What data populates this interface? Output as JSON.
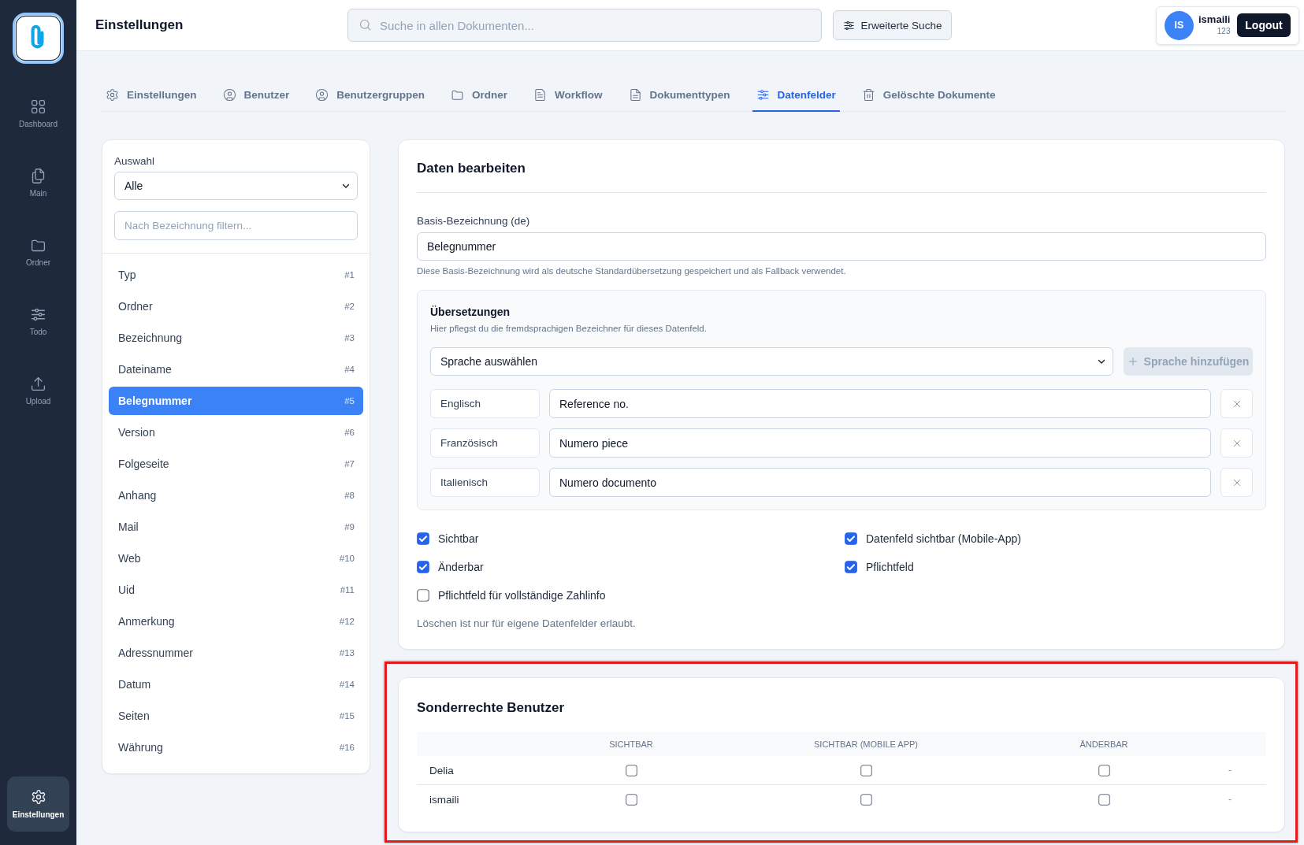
{
  "sidebar": {
    "items": [
      {
        "label": "Dashboard",
        "selected": false
      },
      {
        "label": "Main",
        "selected": false
      },
      {
        "label": "Ordner",
        "selected": false
      },
      {
        "label": "Todo",
        "selected": false
      },
      {
        "label": "Upload",
        "selected": false
      }
    ],
    "bottom_items": [
      {
        "label": "Einstellungen",
        "selected": true
      }
    ]
  },
  "header": {
    "title": "Einstellungen",
    "search": {
      "placeholder": "Suche in allen Dokumenten..."
    },
    "advanced_search_button": "Erweiterte Suche",
    "user": {
      "initials": "IS",
      "name": "ismaili",
      "detail": "123"
    },
    "logout_button": "Logout"
  },
  "tabs": [
    {
      "label": "Einstellungen",
      "selected": false
    },
    {
      "label": "Benutzer",
      "selected": false
    },
    {
      "label": "Benutzergruppen",
      "selected": false
    },
    {
      "label": "Ordner",
      "selected": false
    },
    {
      "label": "Workflow",
      "selected": false
    },
    {
      "label": "Dokumenttypen",
      "selected": false
    },
    {
      "label": "Datenfelder",
      "selected": true
    },
    {
      "label": "Gelöschte Dokumente",
      "selected": false
    }
  ],
  "field_list": {
    "selection_label": "Auswahl",
    "selection_value": "Alle",
    "filter": {
      "placeholder": "Nach Bezeichnung filtern..."
    },
    "items": [
      {
        "label": "Typ",
        "number": "#1",
        "selected": false
      },
      {
        "label": "Ordner",
        "number": "#2",
        "selected": false
      },
      {
        "label": "Bezeichnung",
        "number": "#3",
        "selected": false
      },
      {
        "label": "Dateiname",
        "number": "#4",
        "selected": false
      },
      {
        "label": "Belegnummer",
        "number": "#5",
        "selected": true
      },
      {
        "label": "Version",
        "number": "#6",
        "selected": false
      },
      {
        "label": "Folgeseite",
        "number": "#7",
        "selected": false
      },
      {
        "label": "Anhang",
        "number": "#8",
        "selected": false
      },
      {
        "label": "Mail",
        "number": "#9",
        "selected": false
      },
      {
        "label": "Web",
        "number": "#10",
        "selected": false
      },
      {
        "label": "Uid",
        "number": "#11",
        "selected": false
      },
      {
        "label": "Anmerkung",
        "number": "#12",
        "selected": false
      },
      {
        "label": "Adressnummer",
        "number": "#13",
        "selected": false
      },
      {
        "label": "Datum",
        "number": "#14",
        "selected": false
      },
      {
        "label": "Seiten",
        "number": "#15",
        "selected": false
      },
      {
        "label": "Währung",
        "number": "#16",
        "selected": false
      }
    ]
  },
  "editor": {
    "title": "Daten bearbeiten",
    "base_label_field": {
      "label": "Basis-Bezeichnung (de)",
      "value": "Belegnummer",
      "help": "Diese Basis-Bezeichnung wird als deutsche Standardübersetzung gespeichert und als Fallback verwendet."
    },
    "translations": {
      "title": "Übersetzungen",
      "description": "Hier pflegst du die fremdsprachigen Bezeichner für dieses Datenfeld.",
      "language_select": "Sprache auswählen",
      "add_button": {
        "label": "Sprache hinzufügen",
        "disabled": true
      },
      "rows": [
        {
          "language": "Englisch",
          "value": "Reference no."
        },
        {
          "language": "Französisch",
          "value": "Numero piece"
        },
        {
          "language": "Italienisch",
          "value": "Numero documento"
        }
      ]
    },
    "options": [
      {
        "label": "Sichtbar",
        "checked": true
      },
      {
        "label": "Datenfeld sichtbar (Mobile-App)",
        "checked": true
      },
      {
        "label": "Änderbar",
        "checked": true
      },
      {
        "label": "Pflichtfeld",
        "checked": true
      },
      {
        "label": "Pflichtfeld für vollständige Zahlinfo",
        "checked": false
      }
    ],
    "note": "Löschen ist nur für eigene Datenfelder erlaubt."
  },
  "special_permissions": {
    "highlighted": true,
    "title": "Sonderrechte Benutzer",
    "columns": [
      "SICHTBAR",
      "SICHTBAR (MOBILE APP)",
      "ÄNDERBAR"
    ],
    "rows": [
      {
        "name": "Delia",
        "permissions": [
          {
            "checked": false
          },
          {
            "checked": false
          },
          {
            "checked": false
          }
        ],
        "column_5": "-"
      },
      {
        "name": "ismaili",
        "permissions": [
          {
            "checked": false
          },
          {
            "checked": false
          },
          {
            "checked": false
          }
        ],
        "column_5": "-"
      }
    ]
  }
}
